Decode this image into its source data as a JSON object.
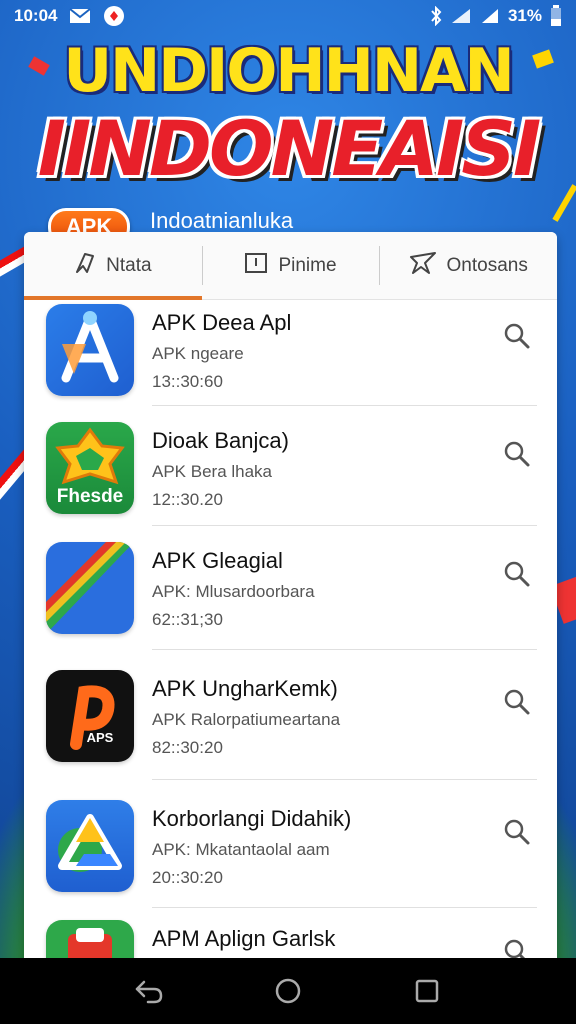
{
  "status": {
    "time": "10:04",
    "battery": "31%"
  },
  "banner": {
    "line1": "UNDIOHHNAN",
    "line2": "IINDONEAISI",
    "badge": "APK",
    "brand": "Indoatnianluka"
  },
  "tabs": [
    {
      "label": "Ntata",
      "icon": "home-icon",
      "active": true
    },
    {
      "label": "Pinime",
      "icon": "clipboard-icon",
      "active": false
    },
    {
      "label": "Ontosans",
      "icon": "star-icon",
      "active": false
    }
  ],
  "apps": [
    {
      "name": "APK Deea Apl",
      "subtitle": "APK ngeare",
      "meta": "13::30:60",
      "icon": "blue-a-app-icon"
    },
    {
      "name": "Dioak Banjca)",
      "subtitle": "APK Bera lhaka",
      "meta": "12::30.20",
      "icon": "green-star-app-icon",
      "icon_text": "Fhesde"
    },
    {
      "name": "APK Gleagial",
      "subtitle": "APK: Mlusardoorbara",
      "meta": "62::31;30",
      "icon": "diagonal-stripe-app-icon"
    },
    {
      "name": "APK UngharKemk)",
      "subtitle": "APK Ralorpatiumeartana",
      "meta": "82::30:20",
      "icon": "orange-p-app-icon",
      "icon_text": "APS"
    },
    {
      "name": "Korborlangi Didahik)",
      "subtitle": "APK: Mkatantaolal aam",
      "meta": "20::30:20",
      "icon": "drive-triangle-app-icon"
    },
    {
      "name": "APM Aplign Garlsk",
      "subtitle": "",
      "meta": "",
      "icon": "green-red-app-icon"
    }
  ],
  "colors": {
    "accent": "#e2762a",
    "banner_yellow": "#ffe21a",
    "banner_red": "#e8202a"
  }
}
